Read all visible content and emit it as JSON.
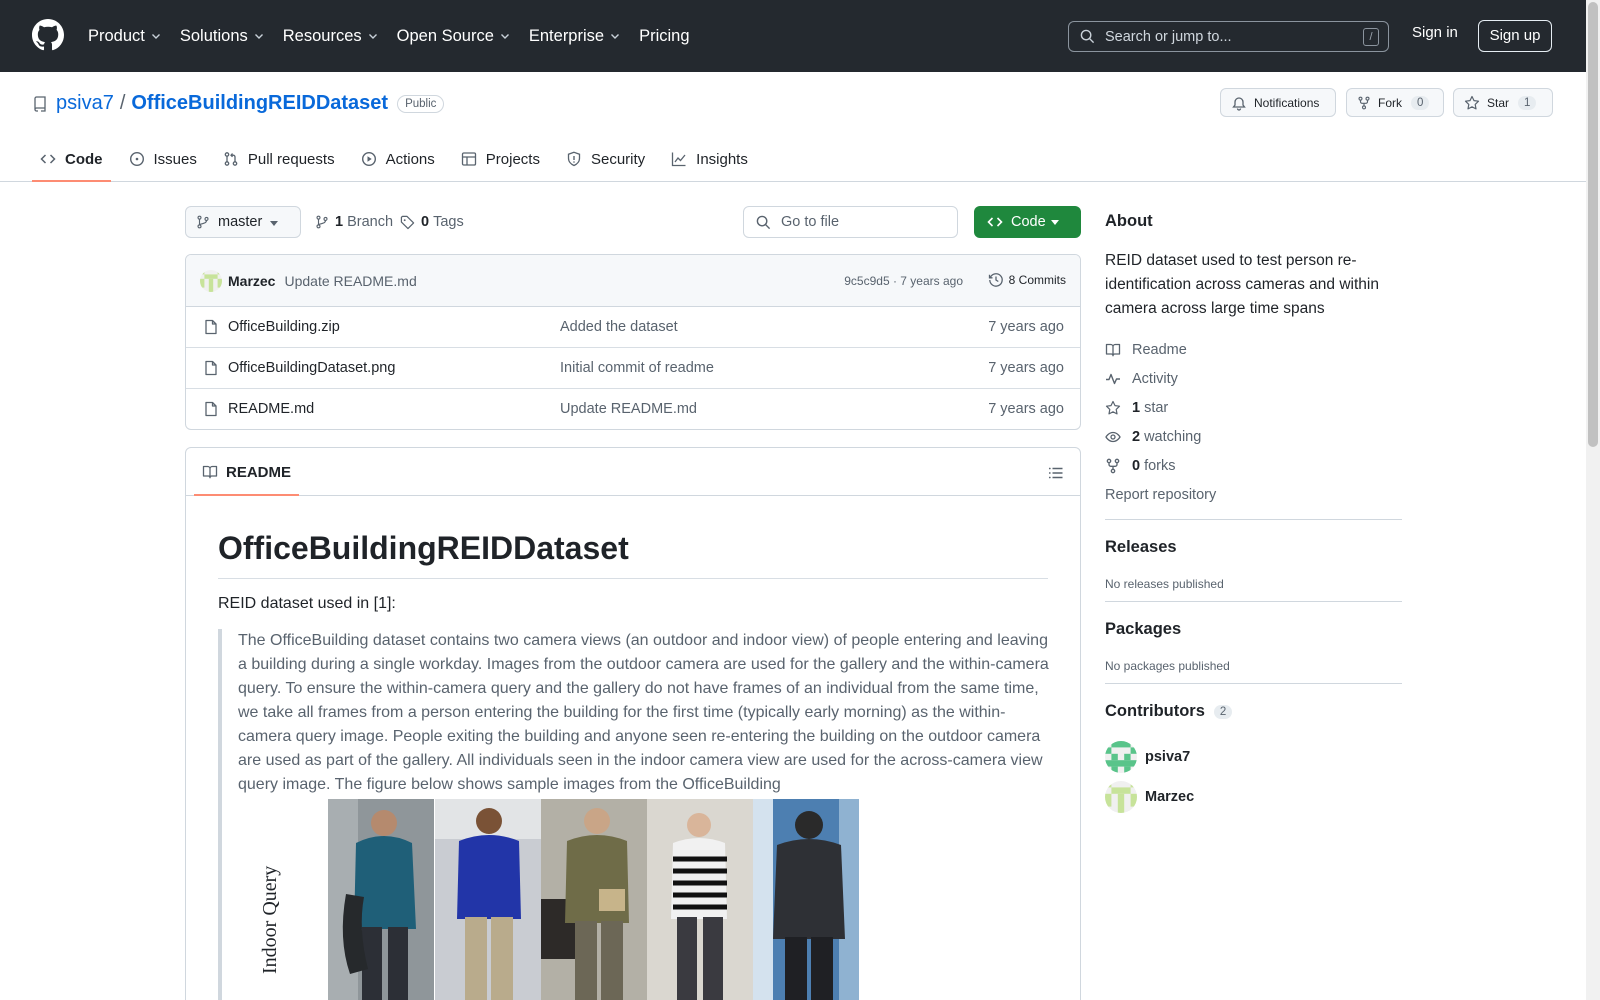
{
  "header": {
    "nav": [
      "Product",
      "Solutions",
      "Resources",
      "Open Source",
      "Enterprise",
      "Pricing"
    ],
    "search_placeholder": "Search or jump to...",
    "search_key": "/",
    "sign_in": "Sign in",
    "sign_up": "Sign up"
  },
  "repo": {
    "owner": "psiva7",
    "separator": "/",
    "name": "OfficeBuildingREIDDataset",
    "visibility": "Public",
    "notifications": "Notifications",
    "fork_label": "Fork",
    "fork_count": "0",
    "star_label": "Star",
    "star_count": "1"
  },
  "tabs": [
    "Code",
    "Issues",
    "Pull requests",
    "Actions",
    "Projects",
    "Security",
    "Insights"
  ],
  "toolbar": {
    "branch": "master",
    "branch_count": "1",
    "branch_label": "Branch",
    "tag_count": "0",
    "tag_label": "Tags",
    "goto_placeholder": "Go to file",
    "code_button": "Code"
  },
  "commit": {
    "author": "Marzec",
    "message": "Update README.md",
    "meta": "9c5c9d5 · 7 years ago",
    "commits": "8 Commits"
  },
  "files": [
    {
      "name": "OfficeBuilding.zip",
      "message": "Added the dataset",
      "time": "7 years ago"
    },
    {
      "name": "OfficeBuildingDataset.png",
      "message": "Initial commit of readme",
      "time": "7 years ago"
    },
    {
      "name": "README.md",
      "message": "Update README.md",
      "time": "7 years ago"
    }
  ],
  "readme": {
    "tab": "README",
    "title": "OfficeBuildingREIDDataset",
    "lead": "REID dataset used in [1]:",
    "quote": "The OfficeBuilding dataset contains two camera views (an outdoor and indoor view) of people entering and leaving a building during a single workday. Images from the outdoor camera are used for the gallery and the within-camera query. To ensure the within-camera query and the gallery do not have frames of an individual from the same time, we take all frames from a person entering the building for the first time (typically early morning) as the within-camera query image. People exiting the building and anyone seen re-entering the building on the outdoor camera are used as part of the gallery. All individuals seen in the indoor camera view are used for the across-camera view query image. The figure below shows sample images from the OfficeBuilding",
    "figure_label": "Indoor Query"
  },
  "about": {
    "heading": "About",
    "description": "REID dataset used to test person re-identification across cameras and within camera across large time spans",
    "readme": "Readme",
    "activity": "Activity",
    "stars_count": "1",
    "stars_label": "star",
    "watching_count": "2",
    "watching_label": "watching",
    "forks_count": "0",
    "forks_label": "forks",
    "report": "Report repository"
  },
  "releases": {
    "heading": "Releases",
    "text": "No releases published"
  },
  "packages": {
    "heading": "Packages",
    "text": "No packages published"
  },
  "contributors": {
    "heading": "Contributors",
    "count": "2",
    "people": [
      "psiva7",
      "Marzec"
    ]
  },
  "colors": {
    "header_bg": "#24292f",
    "link": "#0969da",
    "code_button": "#1f883d",
    "tab_underline": "#fd8c73"
  }
}
